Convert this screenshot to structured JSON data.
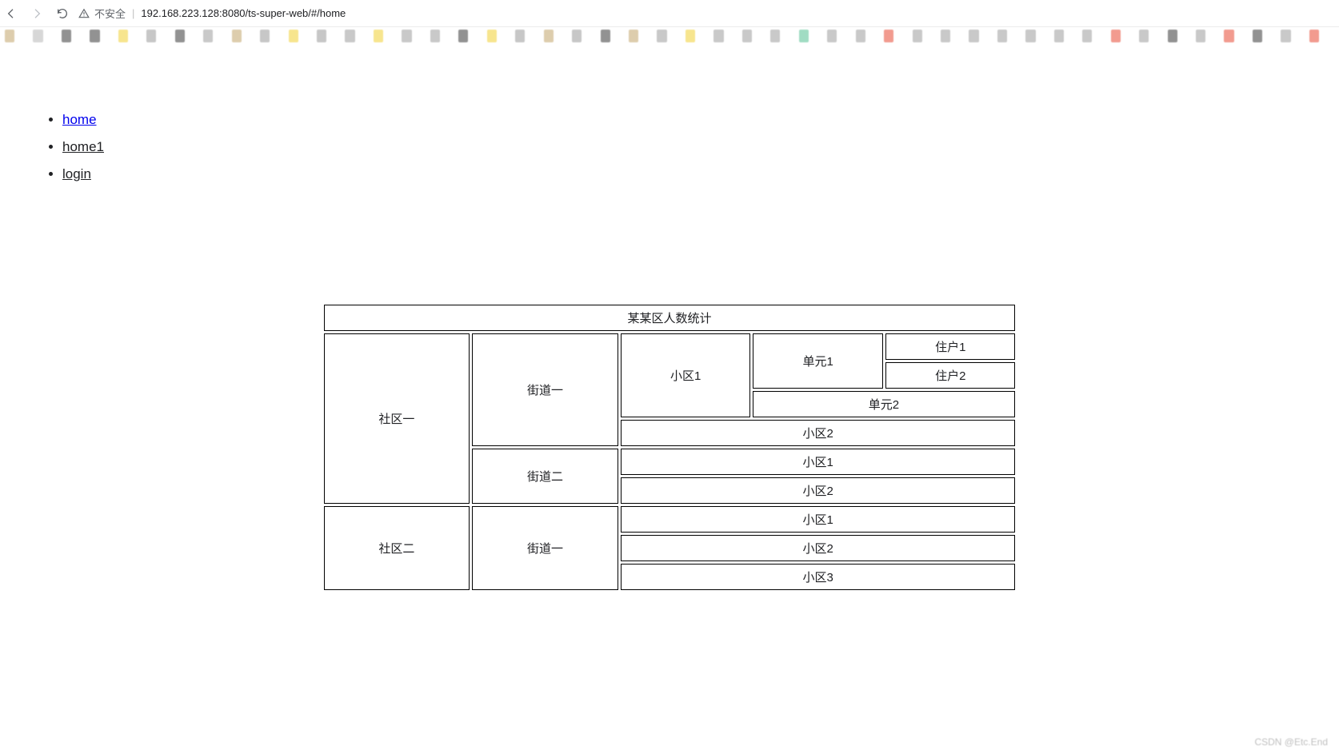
{
  "browser": {
    "security_label": "不安全",
    "url": "192.168.223.128:8080/ts-super-web/#/home"
  },
  "nav_links": [
    {
      "label": "home",
      "active": true
    },
    {
      "label": "home1",
      "active": false
    },
    {
      "label": "login",
      "active": false
    }
  ],
  "table": {
    "title": "某某区人数统计",
    "rows": {
      "community1": "社区一",
      "community2": "社区二",
      "street1": "街道一",
      "street2": "街道二",
      "street1b": "街道一",
      "block1": "小区1",
      "block2": "小区2",
      "block1b": "小区1",
      "block2b": "小区2",
      "block1c": "小区1",
      "block2c": "小区2",
      "block3c": "小区3",
      "unit1": "单元1",
      "unit2": "单元2",
      "household1": "住户1",
      "household2": "住户2"
    }
  },
  "watermark": "CSDN @Etc.End",
  "bookmark_colors": [
    "#d7c49f",
    "#d0d0d0",
    "#7f7f7f",
    "#7f7f7f",
    "#f6e07a",
    "#bdbdbd",
    "#7f7f7f",
    "#c0c0c0",
    "#d7c49f",
    "#bdbdbd",
    "#f6e07a",
    "#bdbdbd",
    "#c0c0c0",
    "#f6e07a",
    "#c0c0c0",
    "#c0c0c0",
    "#7f7f7f",
    "#f6e07a",
    "#bdbdbd",
    "#d7c49f",
    "#bdbdbd",
    "#7f7f7f",
    "#d7c49f",
    "#c0c0c0",
    "#f6e07a",
    "#c0c0c0",
    "#c0c0c0",
    "#c0c0c0",
    "#8fd6b8",
    "#c0c0c0",
    "#c0c0c0",
    "#f0897b",
    "#c0c0c0",
    "#c0c0c0",
    "#c0c0c0",
    "#c0c0c0",
    "#c0c0c0",
    "#c0c0c0",
    "#c0c0c0",
    "#f0897b",
    "#c0c0c0",
    "#7f7f7f",
    "#c0c0c0",
    "#f0897b",
    "#7f7f7f",
    "#c0c0c0",
    "#f0897b"
  ]
}
